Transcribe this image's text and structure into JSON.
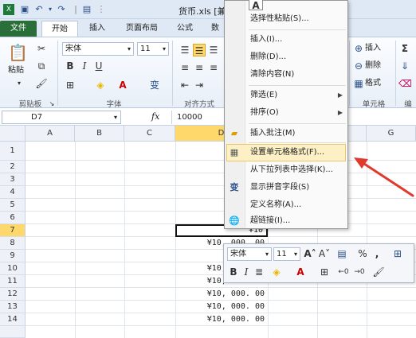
{
  "title_bar": {
    "title": "货币.xls  [兼"
  },
  "tabs": [
    "文件",
    "开始",
    "插入",
    "页面布局",
    "公式",
    "数"
  ],
  "ribbon": {
    "clipboard_label": "剪贴板",
    "paste_label": "粘贴",
    "font_name": "宋体",
    "font_size": "11",
    "font_group_label": "字体",
    "align_group_label": "对齐方式",
    "cells_group_label": "单元格",
    "cell_insert": "插入",
    "cell_delete": "删除",
    "cell_format": "格式",
    "edit_group_label": "编"
  },
  "formula_bar": {
    "name_box": "D7",
    "fx": "fx",
    "value": "10000"
  },
  "columns": [
    "A",
    "B",
    "C",
    "D",
    "E",
    "F",
    "G"
  ],
  "rows": [
    "1",
    "2",
    "3",
    "4",
    "5",
    "6",
    "7",
    "8",
    "9",
    "10",
    "11",
    "12",
    "13",
    "14"
  ],
  "column_d": [
    "¥10, 0",
    "¥10",
    "¥10",
    "¥10",
    "¥10",
    "¥10",
    "¥10",
    "¥10, 000. 00",
    "¥10",
    "¥10, 000. 00",
    "¥10, 000. 00",
    "¥10, 000. 00",
    "¥10, 000. 00",
    "¥10, 000. 00"
  ],
  "context_menu": {
    "items": [
      {
        "label": "选择性粘贴(S)...",
        "arrow": ""
      },
      {
        "label": "插入(I)...",
        "arrow": ""
      },
      {
        "label": "删除(D)...",
        "arrow": ""
      },
      {
        "label": "清除内容(N)",
        "arrow": ""
      },
      {
        "label": "筛选(E)",
        "arrow": "▶"
      },
      {
        "label": "排序(O)",
        "arrow": "▶"
      },
      {
        "label": "插入批注(M)",
        "arrow": ""
      },
      {
        "label": "设置单元格格式(F)...",
        "arrow": ""
      },
      {
        "label": "从下拉列表中选择(K)...",
        "arrow": ""
      },
      {
        "label": "显示拼音字段(S)",
        "arrow": ""
      },
      {
        "label": "定义名称(A)...",
        "arrow": ""
      },
      {
        "label": "超链接(I)...",
        "arrow": ""
      }
    ],
    "top_icon": "A"
  },
  "mini_toolbar": {
    "font": "宋体",
    "size": "11",
    "percent": "%",
    "comma": ","
  },
  "colors": {
    "file_tab": "#2a6e3a",
    "menu_highlight": "#fdf0c5",
    "arrow": "#e03a2e"
  }
}
